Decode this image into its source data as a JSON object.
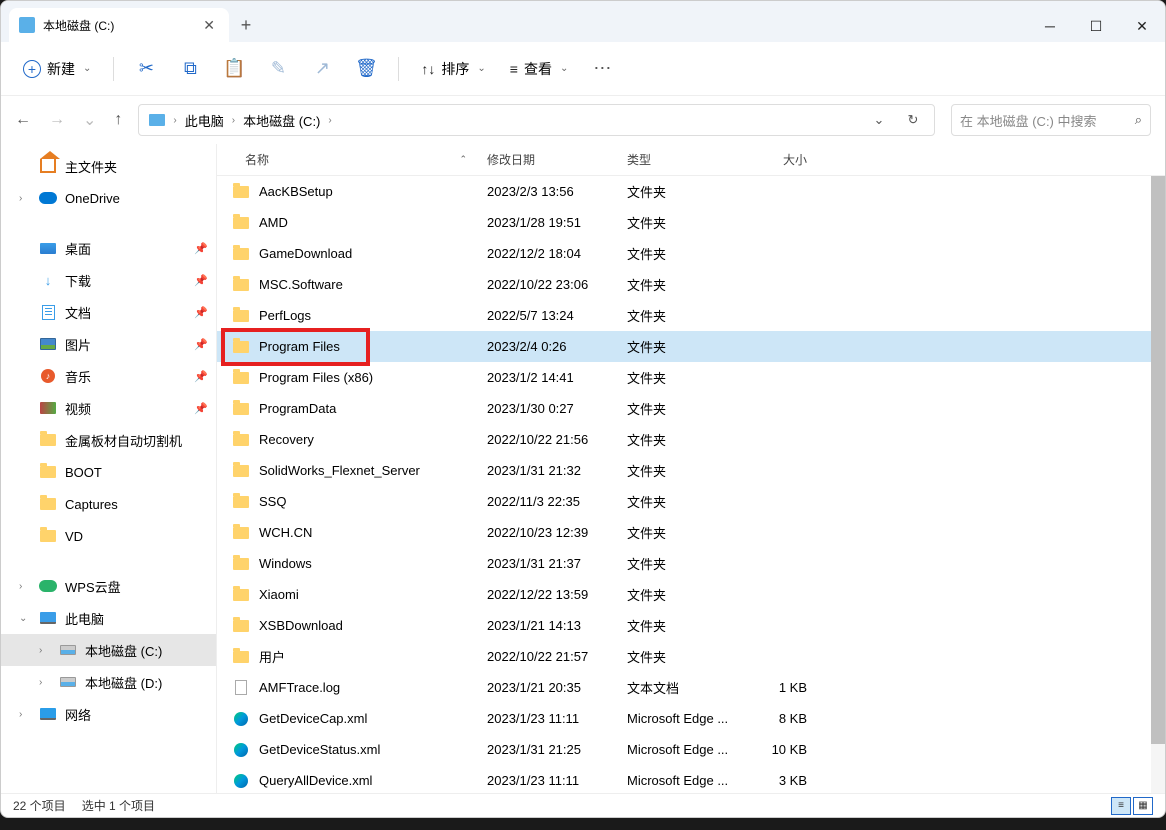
{
  "window": {
    "title": "本地磁盘 (C:)"
  },
  "toolbar": {
    "new": "新建",
    "sort": "排序",
    "view": "查看"
  },
  "breadcrumb": {
    "pc": "此电脑",
    "drive": "本地磁盘 (C:)"
  },
  "search": {
    "placeholder": "在 本地磁盘 (C:) 中搜索"
  },
  "sidebar": {
    "home": "主文件夹",
    "onedrive": "OneDrive",
    "desktop": "桌面",
    "downloads": "下载",
    "documents": "文档",
    "pictures": "图片",
    "music": "音乐",
    "videos": "视频",
    "cut_machine": "金属板材自动切割机",
    "boot": "BOOT",
    "captures": "Captures",
    "vd": "VD",
    "wps": "WPS云盘",
    "this_pc": "此电脑",
    "drive_c": "本地磁盘 (C:)",
    "drive_d": "本地磁盘 (D:)",
    "network": "网络"
  },
  "columns": {
    "name": "名称",
    "date": "修改日期",
    "type": "类型",
    "size": "大小"
  },
  "file_types": {
    "folder": "文件夹",
    "text": "文本文档",
    "edge": "Microsoft Edge ..."
  },
  "files": [
    {
      "name": "AacKBSetup",
      "date": "2023/2/3 13:56",
      "type": "folder",
      "size": "",
      "icon": "folder"
    },
    {
      "name": "AMD",
      "date": "2023/1/28 19:51",
      "type": "folder",
      "size": "",
      "icon": "folder"
    },
    {
      "name": "GameDownload",
      "date": "2022/12/2 18:04",
      "type": "folder",
      "size": "",
      "icon": "folder"
    },
    {
      "name": "MSC.Software",
      "date": "2022/10/22 23:06",
      "type": "folder",
      "size": "",
      "icon": "folder"
    },
    {
      "name": "PerfLogs",
      "date": "2022/5/7 13:24",
      "type": "folder",
      "size": "",
      "icon": "folder"
    },
    {
      "name": "Program Files",
      "date": "2023/2/4 0:26",
      "type": "folder",
      "size": "",
      "icon": "folder",
      "selected": true,
      "highlighted": true
    },
    {
      "name": "Program Files (x86)",
      "date": "2023/1/2 14:41",
      "type": "folder",
      "size": "",
      "icon": "folder"
    },
    {
      "name": "ProgramData",
      "date": "2023/1/30 0:27",
      "type": "folder",
      "size": "",
      "icon": "folder"
    },
    {
      "name": "Recovery",
      "date": "2022/10/22 21:56",
      "type": "folder",
      "size": "",
      "icon": "folder"
    },
    {
      "name": "SolidWorks_Flexnet_Server",
      "date": "2023/1/31 21:32",
      "type": "folder",
      "size": "",
      "icon": "folder"
    },
    {
      "name": "SSQ",
      "date": "2022/11/3 22:35",
      "type": "folder",
      "size": "",
      "icon": "folder"
    },
    {
      "name": "WCH.CN",
      "date": "2022/10/23 12:39",
      "type": "folder",
      "size": "",
      "icon": "folder"
    },
    {
      "name": "Windows",
      "date": "2023/1/31 21:37",
      "type": "folder",
      "size": "",
      "icon": "folder"
    },
    {
      "name": "Xiaomi",
      "date": "2022/12/22 13:59",
      "type": "folder",
      "size": "",
      "icon": "folder"
    },
    {
      "name": "XSBDownload",
      "date": "2023/1/21 14:13",
      "type": "folder",
      "size": "",
      "icon": "folder"
    },
    {
      "name": "用户",
      "date": "2022/10/22 21:57",
      "type": "folder",
      "size": "",
      "icon": "folder"
    },
    {
      "name": "AMFTrace.log",
      "date": "2023/1/21 20:35",
      "type": "text",
      "size": "1 KB",
      "icon": "txt"
    },
    {
      "name": "GetDeviceCap.xml",
      "date": "2023/1/23 11:11",
      "type": "edge",
      "size": "8 KB",
      "icon": "edge"
    },
    {
      "name": "GetDeviceStatus.xml",
      "date": "2023/1/31 21:25",
      "type": "edge",
      "size": "10 KB",
      "icon": "edge"
    },
    {
      "name": "QueryAllDevice.xml",
      "date": "2023/1/23 11:11",
      "type": "edge",
      "size": "3 KB",
      "icon": "edge"
    }
  ],
  "status": {
    "count": "22 个项目",
    "selected": "选中 1 个项目"
  }
}
